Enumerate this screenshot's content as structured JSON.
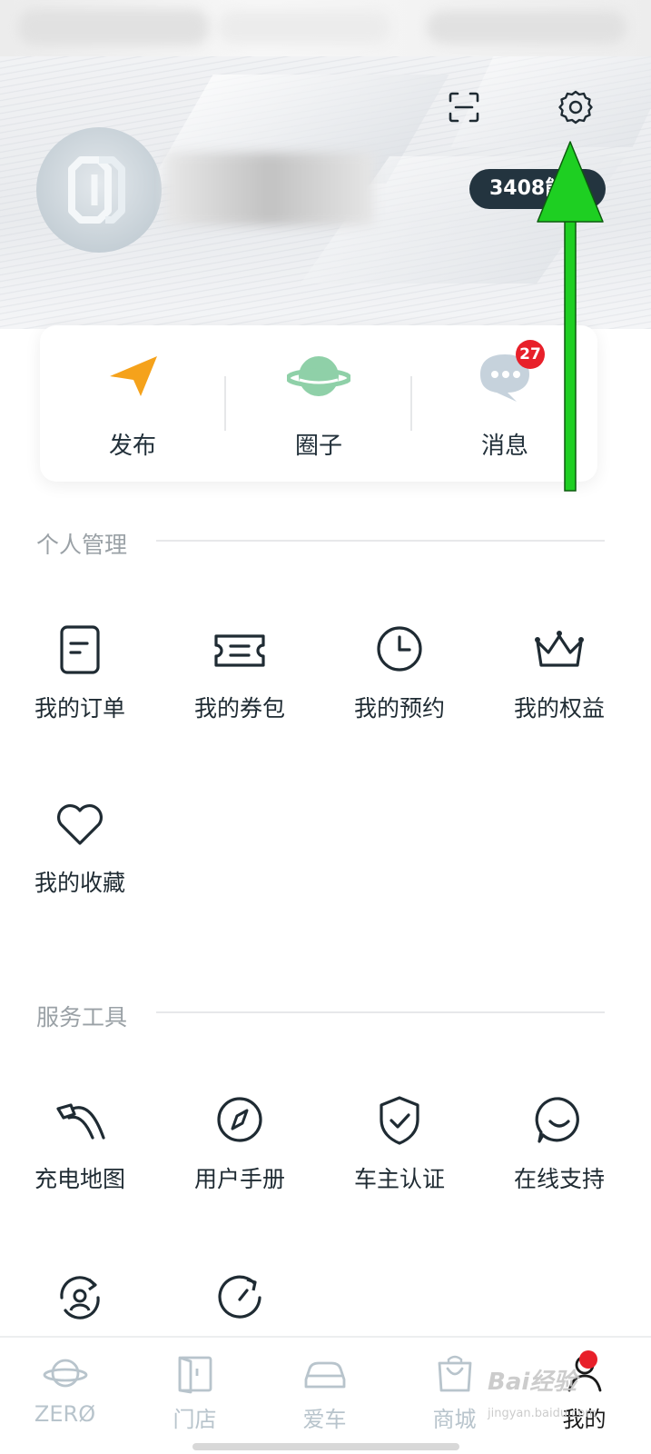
{
  "profile": {
    "points_text": "3408能"
  },
  "quick_actions": [
    {
      "label": "发布",
      "icon": "paper-plane-icon"
    },
    {
      "label": "圈子",
      "icon": "planet-icon"
    },
    {
      "label": "消息",
      "icon": "chat-bubble-icon",
      "badge": "27"
    }
  ],
  "personal": {
    "title": "个人管理",
    "items": [
      {
        "label": "我的订单",
        "icon": "order-document-icon"
      },
      {
        "label": "我的券包",
        "icon": "ticket-icon"
      },
      {
        "label": "我的预约",
        "icon": "clock-icon"
      },
      {
        "label": "我的权益",
        "icon": "crown-icon"
      },
      {
        "label": "我的收藏",
        "icon": "heart-icon"
      }
    ]
  },
  "services": {
    "title": "服务工具",
    "items": [
      {
        "label": "充电地图",
        "icon": "charging-plug-icon"
      },
      {
        "label": "用户手册",
        "icon": "compass-icon"
      },
      {
        "label": "车主认证",
        "icon": "shield-check-icon"
      },
      {
        "label": "在线支持",
        "icon": "smile-chat-icon"
      },
      {
        "label": "",
        "icon": "user-refresh-icon"
      },
      {
        "label": "",
        "icon": "refresh-arrow-icon"
      }
    ]
  },
  "tabbar": {
    "tabs": [
      {
        "label": "ZERØ",
        "icon": "planet-outline-icon"
      },
      {
        "label": "门店",
        "icon": "store-door-icon"
      },
      {
        "label": "爱车",
        "icon": "car-icon"
      },
      {
        "label": "商城",
        "icon": "shopping-bag-icon"
      },
      {
        "label": "我的",
        "icon": "person-icon",
        "active": true
      }
    ]
  },
  "watermark": {
    "text": "Bai经验",
    "sub": "jingyan.baidu.com"
  },
  "colors": {
    "accent_orange": "#f5a21b",
    "planet_green": "#8fd0a8",
    "badge_red": "#e8202a",
    "dark": "#23343f",
    "arrow_green": "#1ecf22"
  }
}
